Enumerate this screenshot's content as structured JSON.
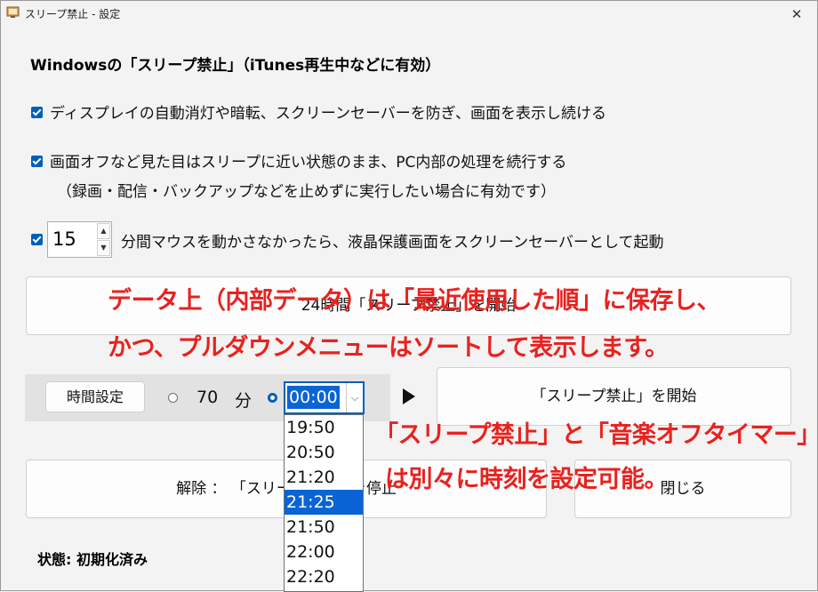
{
  "window": {
    "title": "スリープ禁止 - 設定",
    "close_glyph": "✕"
  },
  "heading": "Windowsの「スリープ禁止」（iTunes再生中などに有効）",
  "options": {
    "display_keep_on": "ディスプレイの自動消灯や暗転、スクリーンセーバーを防ぎ、画面を表示し続ける",
    "away_mode": "画面オフなど見た目はスリープに近い状態のまま、PC内部の処理を続行する",
    "away_mode_note": "（録画・配信・バックアップなどを止めずに実行したい場合に有効です）",
    "screensaver": "分間マウスを動かさなかったら、液晶保護画面をスクリーンセーバーとして起動"
  },
  "screensaver_minutes": "15",
  "buttons": {
    "start_24h": "24時間「スリープ禁止」を開始",
    "time_setting": "時間設定",
    "start": "「スリープ禁止」を開始",
    "release": "解除 ： 「スリープ禁止」を停止",
    "close": "閉じる"
  },
  "timer": {
    "minutes_value": "70",
    "minutes_unit": "分",
    "selected_time": "00:00",
    "dropdown_items": [
      "19:50",
      "20:50",
      "21:20",
      "21:25",
      "21:50",
      "22:00",
      "22:20"
    ],
    "highlighted_item": "21:25"
  },
  "status": "状態: 初期化済み",
  "annotations": {
    "line1": "データ上（内部データ）は「最近使用した順」に保存し、",
    "line2": "かつ、プルダウンメニューはソートして表示します。",
    "line3": "「スリープ禁止」と「音楽オフタイマー」",
    "line4": "は別々に時刻を設定可能。"
  },
  "colors": {
    "accent": "#005fb8",
    "selection": "#0a64d6",
    "annotation": "#e8221f",
    "window_bg": "#f3f3f3"
  }
}
